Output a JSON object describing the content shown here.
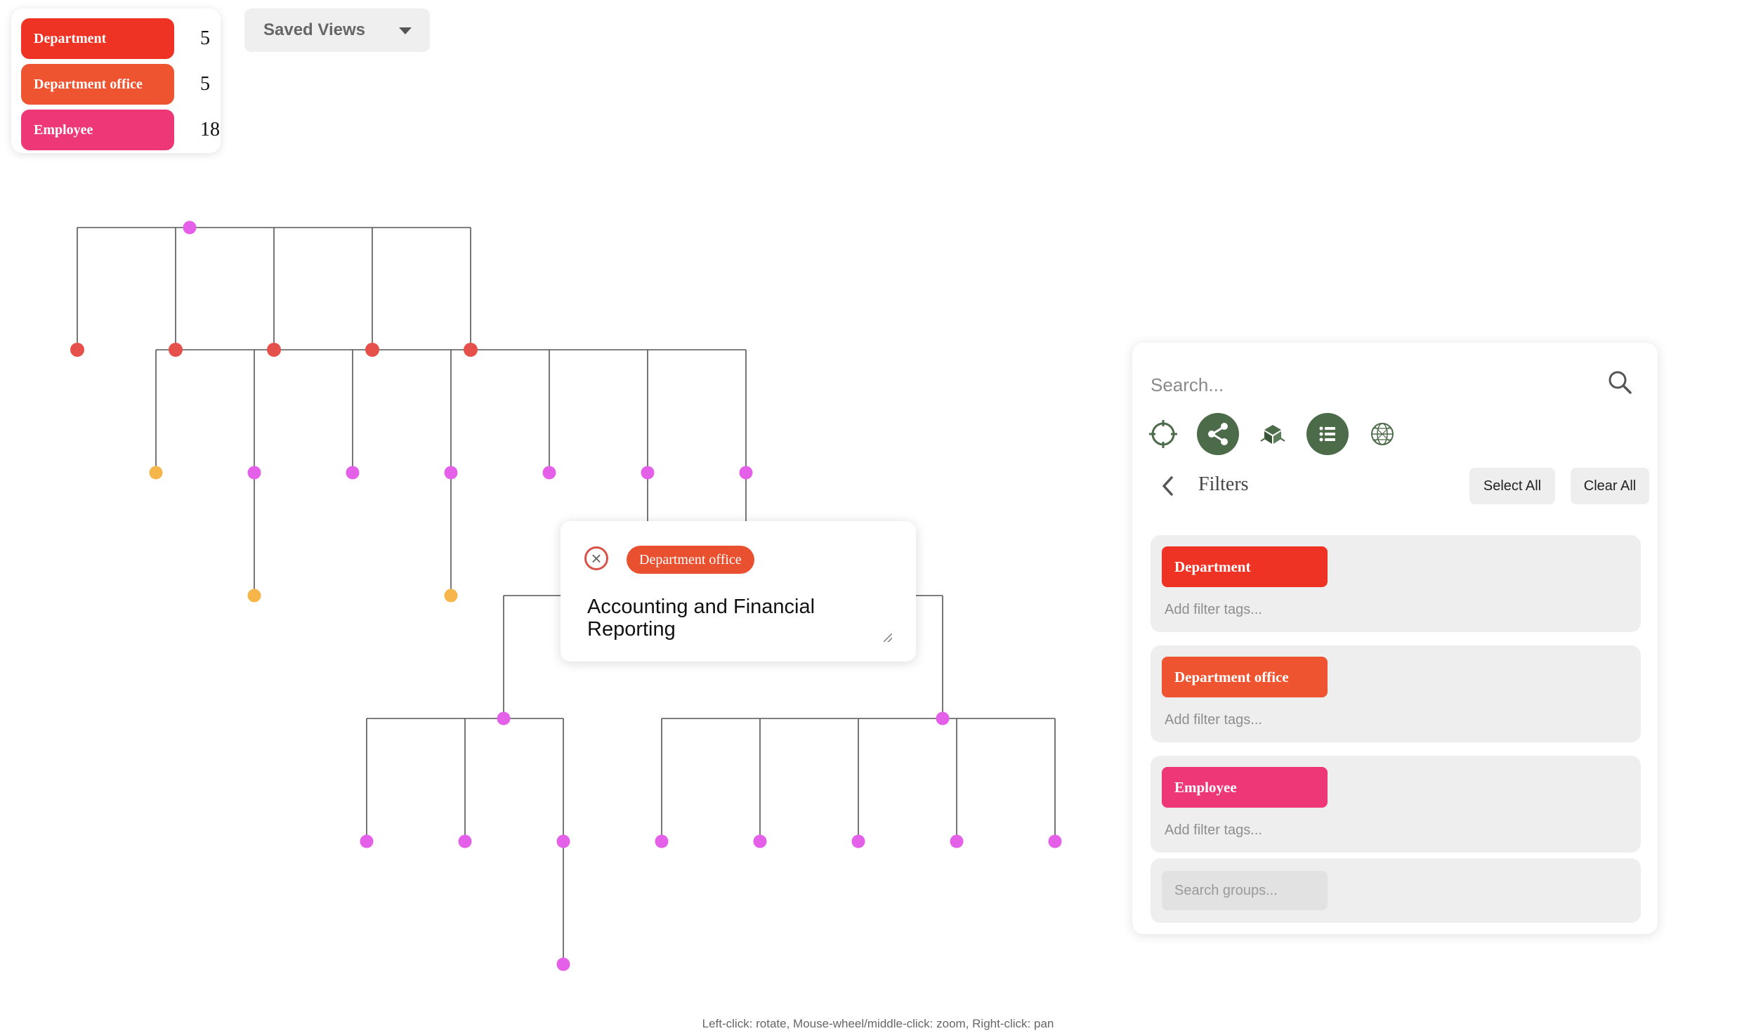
{
  "legend": {
    "items": [
      {
        "label": "Department",
        "count": "5",
        "color": "#ee3325"
      },
      {
        "label": "Department office",
        "count": "5",
        "color": "#ee5430"
      },
      {
        "label": "Employee",
        "count": "18",
        "color": "#ee3777"
      }
    ]
  },
  "saved_views": {
    "label": "Saved Views"
  },
  "graph": {
    "colors": {
      "edge": "#555555",
      "department": "#e6504a",
      "employee": "#e560e8",
      "leaf": "#f7b64a"
    }
  },
  "popup": {
    "type_tag": "Department office",
    "title": "Accounting and Financial Reporting",
    "tag_color": "#e8502f"
  },
  "panel": {
    "search_placeholder": "Search...",
    "filters_title": "Filters",
    "select_all": "Select All",
    "clear_all": "Clear All",
    "toolbar": [
      {
        "icon": "crosshair-icon",
        "active": false
      },
      {
        "icon": "share-network-icon",
        "active": true
      },
      {
        "icon": "cube-icon",
        "active": false
      },
      {
        "icon": "list-icon",
        "active": true
      },
      {
        "icon": "globe-icon",
        "active": false
      }
    ],
    "filters": [
      {
        "label": "Department",
        "placeholder": "Add filter tags...",
        "color": "#ee3325"
      },
      {
        "label": "Department office",
        "placeholder": "Add filter tags...",
        "color": "#ee5430"
      },
      {
        "label": "Employee",
        "placeholder": "Add filter tags...",
        "color": "#ee3777"
      }
    ],
    "group_search_placeholder": "Search groups..."
  },
  "hint": "Left-click: rotate, Mouse-wheel/middle-click: zoom, Right-click: pan"
}
